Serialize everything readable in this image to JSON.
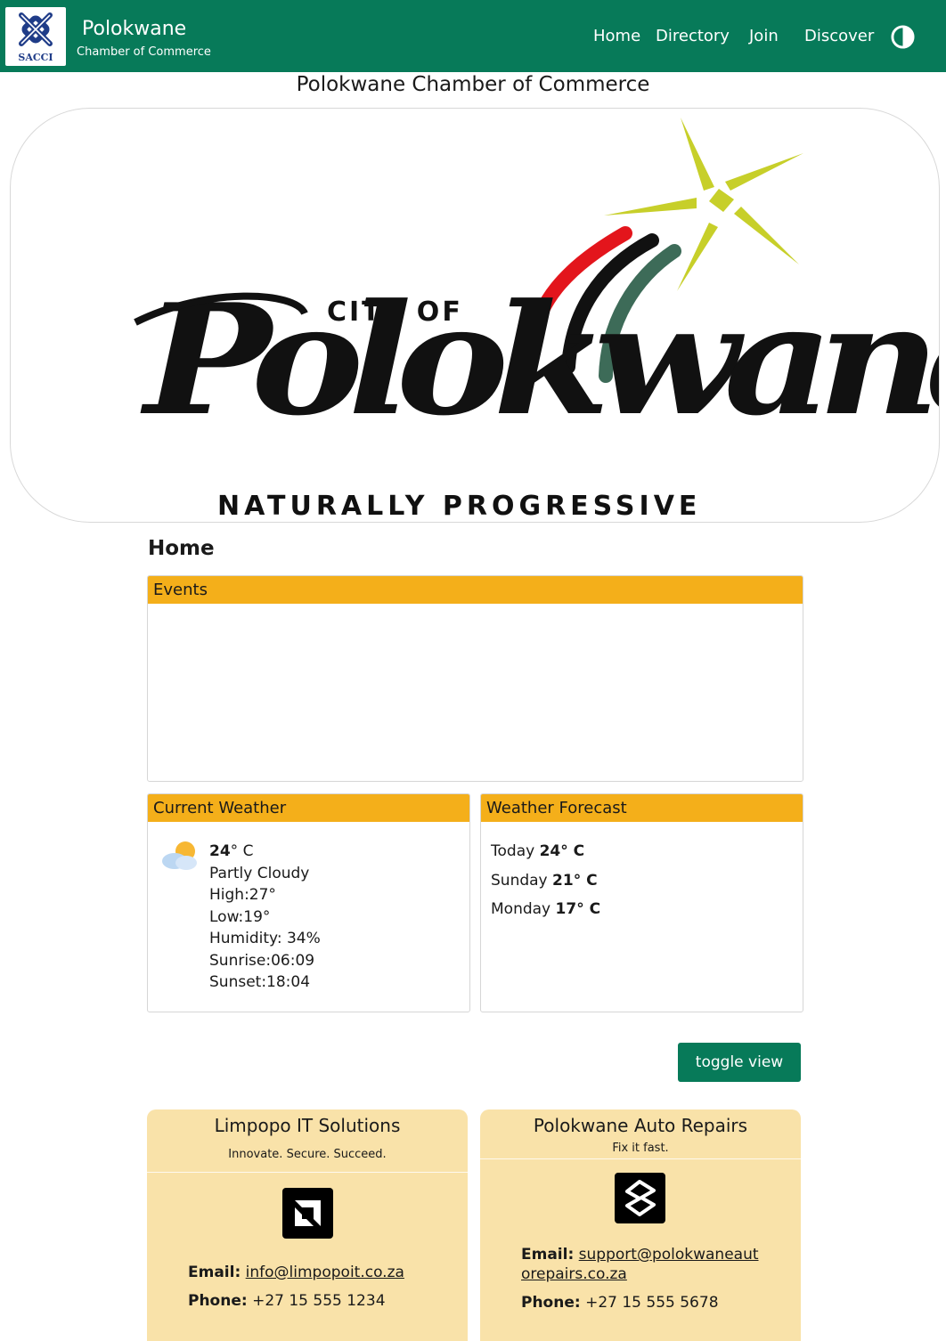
{
  "header": {
    "logo_text": "SACCI",
    "brand_title": "Polokwane",
    "brand_subtitle": "Chamber of Commerce",
    "nav": [
      "Home",
      "Directory",
      "Join",
      "Discover"
    ],
    "contrast_icon": "contrast-toggle-icon"
  },
  "page": {
    "title": "Polokwane Chamber of Commerce",
    "hero_logo_text": {
      "top": "CITY OF",
      "main": "Polokwane",
      "slogan": "NATURALLY PROGRESSIVE"
    },
    "heading": "Home"
  },
  "events": {
    "title": "Events"
  },
  "current_weather": {
    "title": "Current Weather",
    "icon": "partly-cloudy-icon",
    "temp": "24",
    "unit": "° C",
    "condition": "Partly Cloudy",
    "high": "High:27°",
    "low": "Low:19°",
    "humidity": "Humidity: 34%",
    "sunrise": "Sunrise:06:09",
    "sunset": "Sunset:18:04"
  },
  "forecast": {
    "title": "Weather Forecast",
    "days": [
      {
        "day": "Today",
        "temp": "24",
        "unit": "° C"
      },
      {
        "day": "Sunday",
        "temp": "21",
        "unit": "° C"
      },
      {
        "day": "Monday",
        "temp": "17",
        "unit": "° C"
      }
    ]
  },
  "toggle_label": "toggle view",
  "businesses": [
    {
      "name": "Limpopo IT Solutions",
      "tagline": "Innovate. Secure. Succeed.",
      "logo_icon": "amd-style-logo-icon",
      "email_label": "Email:",
      "email": "info@limpopoit.co.za",
      "phone_label": "Phone:",
      "phone": "+27 15 555 1234"
    },
    {
      "name": "Polokwane Auto Repairs",
      "tagline": "Fix it fast.",
      "logo_icon": "auto-repair-logo-icon",
      "email_label": "Email:",
      "email": "support@polokwaneautorepairs.co.za",
      "phone_label": "Phone:",
      "phone": "+27 15 555 5678"
    }
  ],
  "colors": {
    "header_green": "#077a59",
    "card_header_amber": "#f4af1a",
    "tile_bg": "#f9e2a9"
  }
}
